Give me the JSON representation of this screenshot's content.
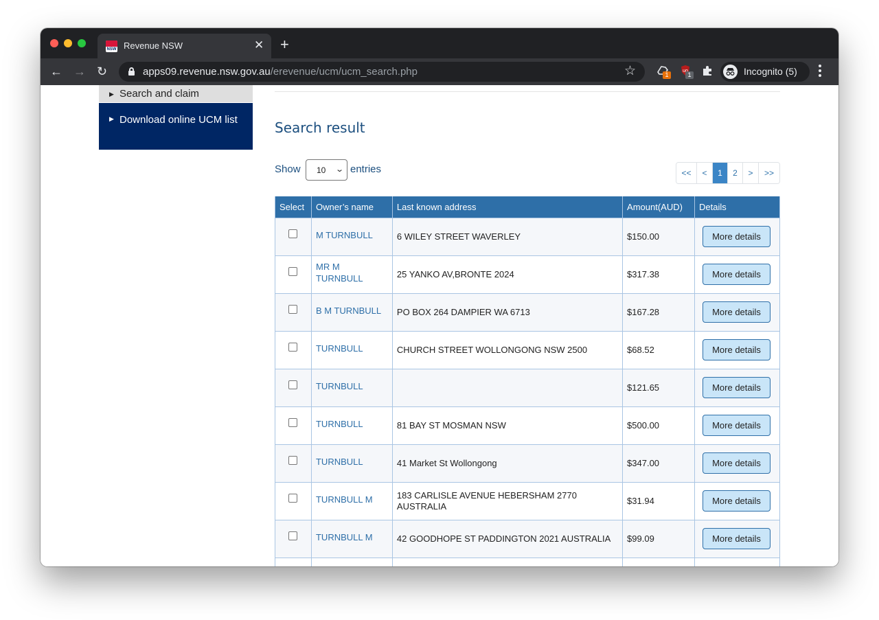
{
  "browser": {
    "tab_title": "Revenue NSW",
    "tab_close": "✕",
    "new_tab": "+",
    "url_host": "apps09.revenue.nsw.gov.au",
    "url_path": "/erevenue/ucm/ucm_search.php",
    "ext1_badge": "1",
    "ext2_badge": "1",
    "profile_label": "Incognito (5)",
    "favicon_text": "NSW"
  },
  "sidebar": {
    "prev_item": "Search and claim",
    "active_item": "Download online UCM list"
  },
  "main": {
    "section_title": "Search result",
    "show_label": "Show",
    "entries_value": "10",
    "entries_label": "entries",
    "pagination": [
      "<<",
      "<",
      "1",
      "2",
      ">",
      ">>"
    ],
    "active_page": "1"
  },
  "table": {
    "headers": [
      "Select",
      "Owner’s name",
      "Last known address",
      "Amount(AUD)",
      "Details"
    ],
    "button_label": "More details",
    "rows": [
      {
        "owner": "M TURNBULL",
        "address": "6 WILEY STREET WAVERLEY",
        "amount": "$150.00"
      },
      {
        "owner": "MR M TURNBULL",
        "address": "25 YANKO AV,BRONTE 2024",
        "amount": "$317.38"
      },
      {
        "owner": "B M TURNBULL",
        "address": "PO BOX 264 DAMPIER WA 6713",
        "amount": "$167.28"
      },
      {
        "owner": "TURNBULL",
        "address": "CHURCH STREET WOLLONGONG NSW 2500",
        "amount": "$68.52"
      },
      {
        "owner": "TURNBULL",
        "address": "",
        "amount": "$121.65"
      },
      {
        "owner": "TURNBULL",
        "address": "81 BAY ST MOSMAN NSW",
        "amount": "$500.00"
      },
      {
        "owner": "TURNBULL",
        "address": "41 Market St Wollongong",
        "amount": "$347.00"
      },
      {
        "owner": "TURNBULL M",
        "address": "183 CARLISLE AVENUE HEBERSHAM 2770 AUSTRALIA",
        "amount": "$31.94"
      },
      {
        "owner": "TURNBULL M",
        "address": "42 GOODHOPE ST PADDINGTON 2021 AUSTRALIA",
        "amount": "$99.09"
      }
    ]
  }
}
